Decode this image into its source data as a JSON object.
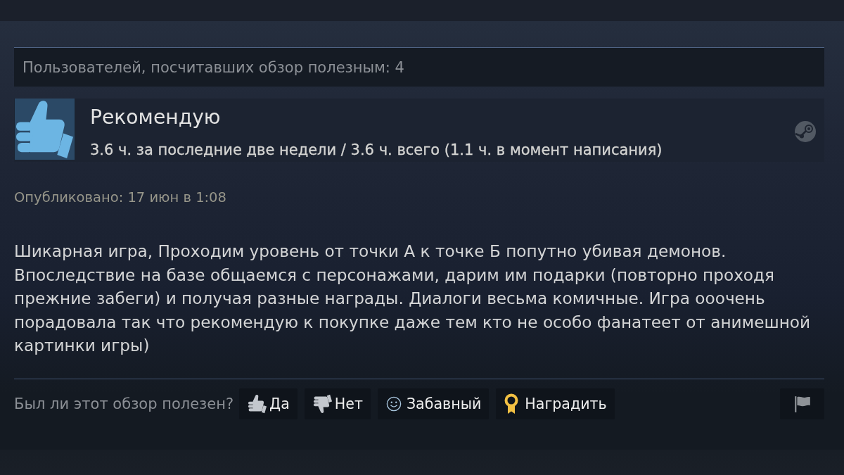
{
  "helpful_bar": {
    "text": "Пользователей, посчитавших обзор полезным: 4"
  },
  "review": {
    "recommended": true,
    "verdict": "Рекомендую",
    "hours": "3.6 ч. за последние две недели / 3.6 ч. всего (1.1 ч. в момент написания)",
    "posted": "Опубликовано: 17 июн в 1:08",
    "text": "Шикарная игра, Проходим уровень от точки А к точке Б попутно убивая демонов. Впоследствие на базе общаемся с персонажами, дарим им подарки (повторно проходя прежние забеги) и получая разные награды. Диалоги весьма комичные. Игра ооочень порадовала так что рекомендую к покупке даже тем кто не особо фанатеет от анимешной картинки игры)"
  },
  "footer": {
    "question": "Был ли этот обзор полезен?",
    "buttons": [
      {
        "kind": "yes",
        "label": "Да"
      },
      {
        "kind": "no",
        "label": "Нет"
      },
      {
        "kind": "funny",
        "label": "Забавный"
      },
      {
        "kind": "award",
        "label": "Наградить"
      },
      {
        "kind": "report"
      }
    ]
  }
}
